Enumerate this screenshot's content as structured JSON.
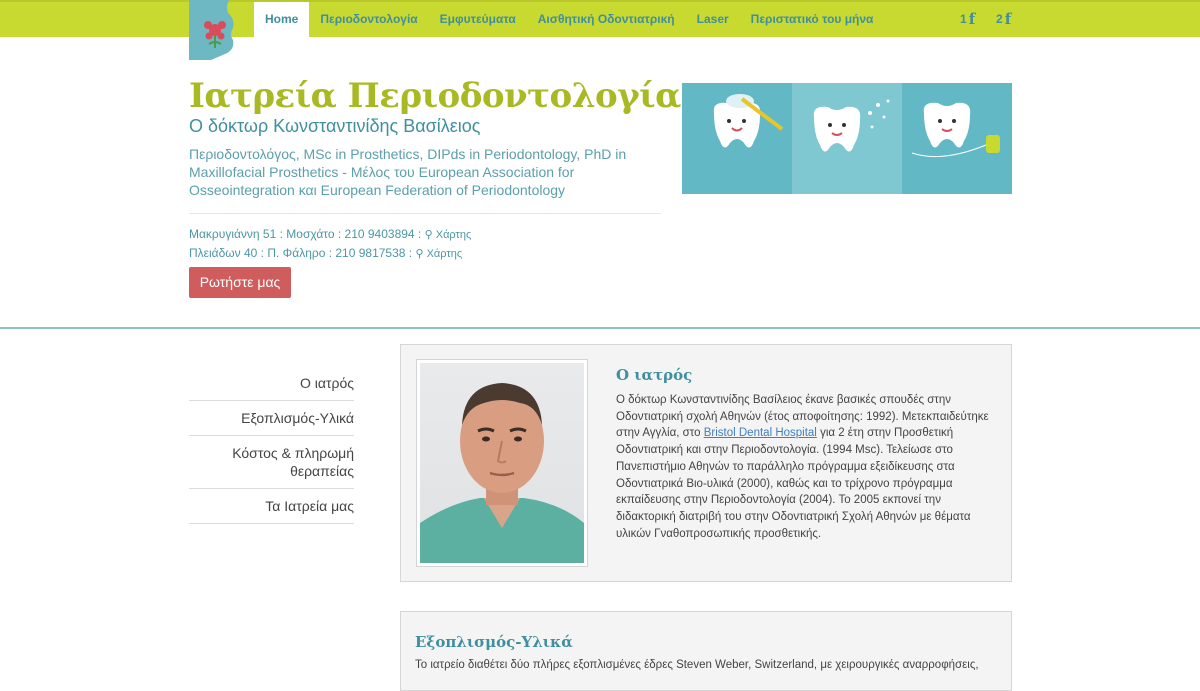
{
  "nav": {
    "items": [
      {
        "label": "Home",
        "active": true
      },
      {
        "label": "Περιοδοντολογία"
      },
      {
        "label": "Εμφυτεύματα"
      },
      {
        "label": "Αισθητική Οδοντιατρική"
      },
      {
        "label": "Laser"
      },
      {
        "label": "Περιστατικό του μήνα"
      }
    ],
    "social": [
      {
        "num": "1",
        "icon": "facebook-icon"
      },
      {
        "num": "2",
        "icon": "facebook-icon"
      }
    ]
  },
  "header": {
    "title": "Ιατρεία Περιοδοντολογίας",
    "subtitle": "Ο δόκτωρ Κωνσταντινίδης Βασίλειος",
    "credentials": "Περιοδοντολόγος, MSc in Prosthetics, DIPds in Periodontology, PhD in Maxillofacial Prosthetics - Μέλος του European Association for Osseointegration και European Federation of Periodontology",
    "addresses": [
      {
        "text": "Μακρυγιάννη 51 : Μοσχάτο : 210 9403894 :",
        "map": "Χάρτης"
      },
      {
        "text": "Πλειάδων 40 : Π. Φάληρο : 210 9817538 :",
        "map": "Χάρτης"
      }
    ],
    "ask_button": "Ρωτήστε μας"
  },
  "sidebar": {
    "items": [
      {
        "label": "Ο ιατρός"
      },
      {
        "label": "Εξοπλισμός-Υλικά"
      },
      {
        "label": "Κόστος & πληρωμή θεραπείας"
      },
      {
        "label": "Τα Ιατρεία μας"
      }
    ]
  },
  "doctor": {
    "title": "Ο ιατρός",
    "bio_part1": "Ο δόκτωρ Κωνσταντινίδης Βασίλειος έκανε βασικές σπουδές στην Οδοντιατρική σχολή Αθηνών (έτος αποφοίτησης: 1992). Μετεκπαιδεύτηκε στην Αγγλία, στο ",
    "bio_link": "Bristol Dental Hospital",
    "bio_part2": " για 2 έτη στην Προσθετική Οδοντιατρική και στην Περιοδοντολογία. (1994 Msc). Τελείωσε στο Πανεπιστήμιο Αθηνών το παράλληλο πρόγραμμα εξειδίκευσης στα Οδοντιατρικά Βιο-υλικά (2000), καθώς και το τρίχρονο πρόγραμμα εκπαίδευσης στην Περιοδοντολογία (2004). Το 2005 εκπονεί την διδακτορική διατριβή του στην Οδοντιατρική Σχολή Αθηνών με θέματα υλικών Γναθοπροσωπικής προσθετικής."
  },
  "equipment": {
    "title": "Εξοπλισμός-Υλικά",
    "text": "Το ιατρείο διαθέτει δύο πλήρες εξοπλισμένες έδρες Steven Weber, Switzerland, με χειρουργικές αναρροφήσεις,"
  },
  "colors": {
    "nav_bg": "#c8d92f",
    "accent_teal": "#3f8f9e",
    "title_olive": "#a9b923",
    "button_red": "#cf5d5d"
  }
}
